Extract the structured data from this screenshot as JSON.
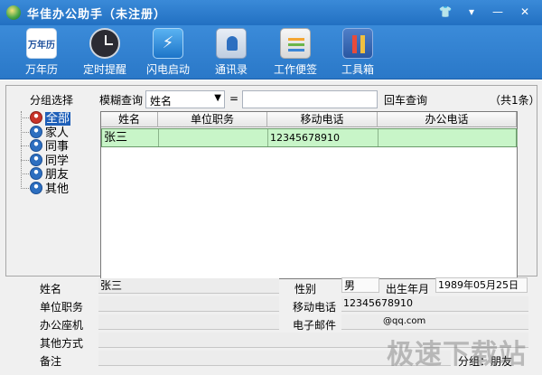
{
  "window": {
    "title": "华佳办公助手（未注册）",
    "controls": [
      "👕",
      "▾",
      "—",
      "✕"
    ]
  },
  "toolbar": {
    "items": [
      {
        "label": "万年历",
        "icon_text": "万年历"
      },
      {
        "label": "定时提醒"
      },
      {
        "label": "闪电启动",
        "icon_text": "⚡"
      },
      {
        "label": "通讯录"
      },
      {
        "label": "工作便签"
      },
      {
        "label": "工具箱"
      }
    ]
  },
  "filter": {
    "group_label": "分组选择",
    "fuzzy_label": "模糊查询",
    "field_value": "姓名",
    "eq_label": "=",
    "search_value": "",
    "enter_label": "回车查询",
    "count_label": "（共1条）"
  },
  "groups": [
    "全部",
    "家人",
    "同事",
    "同学",
    "朋友",
    "其他"
  ],
  "table": {
    "columns": [
      "姓名",
      "单位职务",
      "移动电话",
      "办公电话"
    ],
    "rows": [
      {
        "name": "张三",
        "title": "",
        "mobile": "12345678910",
        "office": ""
      }
    ]
  },
  "detail": {
    "name_label": "姓名",
    "name_value": "张三",
    "title_label": "单位职务",
    "title_value": "",
    "office_label": "办公座机",
    "office_value": "",
    "other_label": "其他方式",
    "other_value": "",
    "note_label": "备注",
    "note_value": "",
    "gender_label": "性别",
    "gender_value": "男",
    "birth_label": "出生年月",
    "birth_value": "1989年05月25日",
    "mobile_label": "移动电话",
    "mobile_value": "12345678910",
    "email_label": "电子邮件",
    "email_value": "@qq.com",
    "group_label": "分组：朋友"
  },
  "watermark": "极速下载站"
}
